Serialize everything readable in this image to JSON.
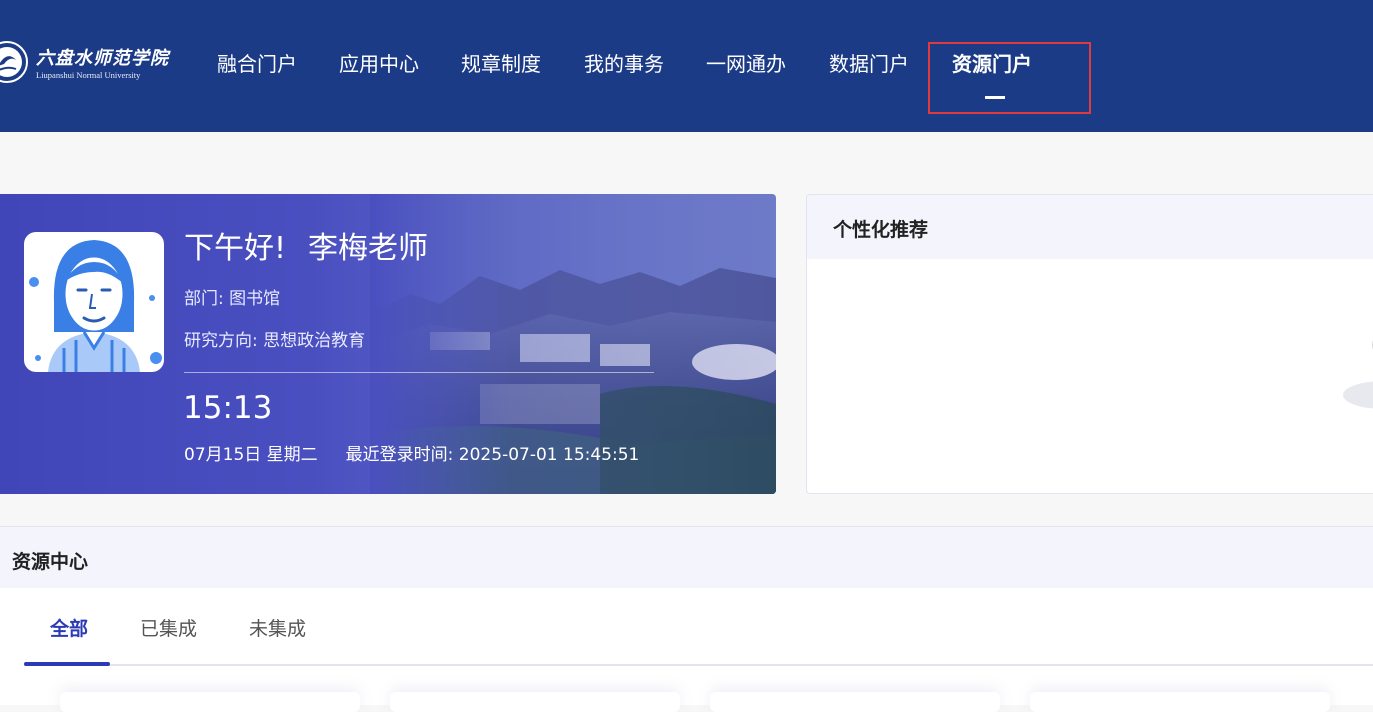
{
  "header": {
    "logo": {
      "cn": "六盘水师范学院",
      "en": "Liupanshui Normal University"
    },
    "nav": [
      {
        "label": "融合门户"
      },
      {
        "label": "应用中心"
      },
      {
        "label": "规章制度"
      },
      {
        "label": "我的事务"
      },
      {
        "label": "一网通办"
      },
      {
        "label": "数据门户"
      },
      {
        "label": "资源门户",
        "active": true
      }
    ],
    "colors": {
      "background": "#1c3b87",
      "highlight_border": "#e0393f"
    }
  },
  "greeting_card": {
    "greeting": "下午好!",
    "name": "李梅老师",
    "department": "部门: 图书馆",
    "research": "研究方向: 思想政治教育",
    "time": "15:13",
    "date": "07月15日 星期二",
    "last_login": "最近登录时间: 2025-07-01 15:45:51",
    "avatar_icon": "teacher-avatar-icon"
  },
  "recommend": {
    "title": "个性化推荐"
  },
  "resource_center": {
    "title": "资源中心",
    "tabs": [
      {
        "label": "全部",
        "active": true
      },
      {
        "label": "已集成"
      },
      {
        "label": "未集成"
      }
    ],
    "accent_color": "#2b3bb5"
  }
}
